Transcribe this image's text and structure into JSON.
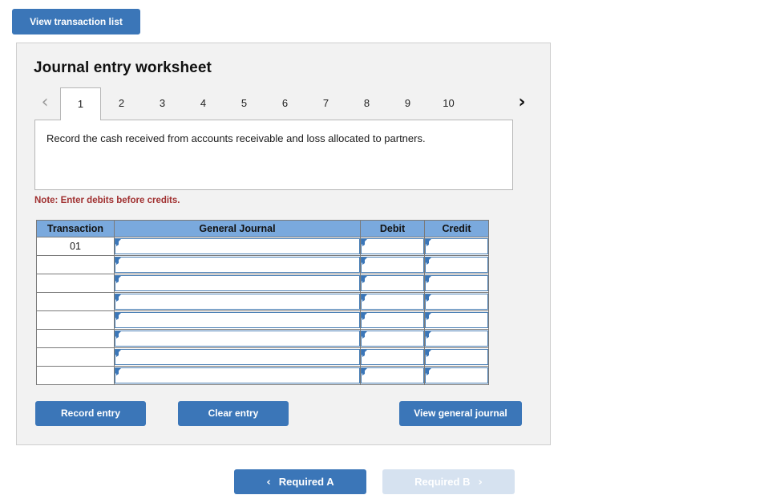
{
  "top": {
    "view_transaction_label": "View transaction list"
  },
  "worksheet": {
    "title": "Journal entry worksheet",
    "tabs": [
      "1",
      "2",
      "3",
      "4",
      "5",
      "6",
      "7",
      "8",
      "9",
      "10"
    ],
    "active_tab": "1",
    "prev_arrow": "‹",
    "next_arrow": "›",
    "description": "Record the cash received from accounts receivable and loss allocated to partners.",
    "note": "Note: Enter debits before credits.",
    "table": {
      "headers": [
        "Transaction",
        "General Journal",
        "Debit",
        "Credit"
      ],
      "rows": [
        {
          "transaction": "01",
          "general_journal": "",
          "debit": "",
          "credit": ""
        },
        {
          "transaction": "",
          "general_journal": "",
          "debit": "",
          "credit": ""
        },
        {
          "transaction": "",
          "general_journal": "",
          "debit": "",
          "credit": ""
        },
        {
          "transaction": "",
          "general_journal": "",
          "debit": "",
          "credit": ""
        },
        {
          "transaction": "",
          "general_journal": "",
          "debit": "",
          "credit": ""
        },
        {
          "transaction": "",
          "general_journal": "",
          "debit": "",
          "credit": ""
        },
        {
          "transaction": "",
          "general_journal": "",
          "debit": "",
          "credit": ""
        },
        {
          "transaction": "",
          "general_journal": "",
          "debit": "",
          "credit": ""
        }
      ]
    },
    "buttons": {
      "record_entry": "Record entry",
      "clear_entry": "Clear entry",
      "view_general_journal": "View general journal"
    }
  },
  "bottom_nav": {
    "prev_label": "Required A",
    "next_label": "Required B",
    "prev_chevron": "‹",
    "next_chevron": "›"
  },
  "colors": {
    "accent_blue": "#3b76b8",
    "table_header_blue": "#7aa9dd",
    "panel_gray": "#f2f2f2",
    "note_red": "#a03030",
    "disabled_blue": "#d6e2f0"
  }
}
